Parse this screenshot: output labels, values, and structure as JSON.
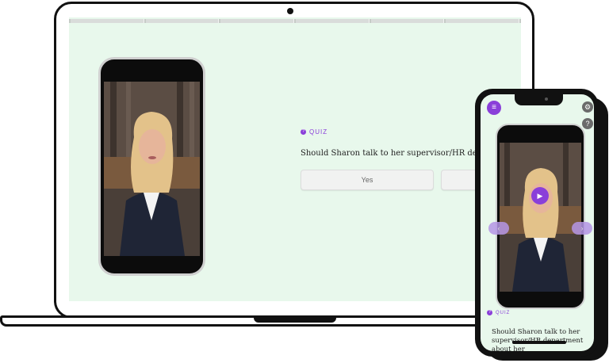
{
  "quiz": {
    "tag": "QUIZ",
    "question": "Should Sharon talk to her supervisor/HR department about",
    "answers": [
      "Yes",
      ""
    ]
  },
  "mobile": {
    "quiz_tag": "QUIZ",
    "question": "Should Sharon talk to her supervisor/HR department about her",
    "menu_icon": "menu-icon",
    "settings_icon": "gear-icon",
    "help_icon": "help-icon",
    "play_icon": "play-icon"
  },
  "progress": {
    "segments": 6
  },
  "colors": {
    "accent": "#8a3fd9",
    "screen_bg": "#e8f8ec",
    "button_bg": "#f1f2f1"
  }
}
